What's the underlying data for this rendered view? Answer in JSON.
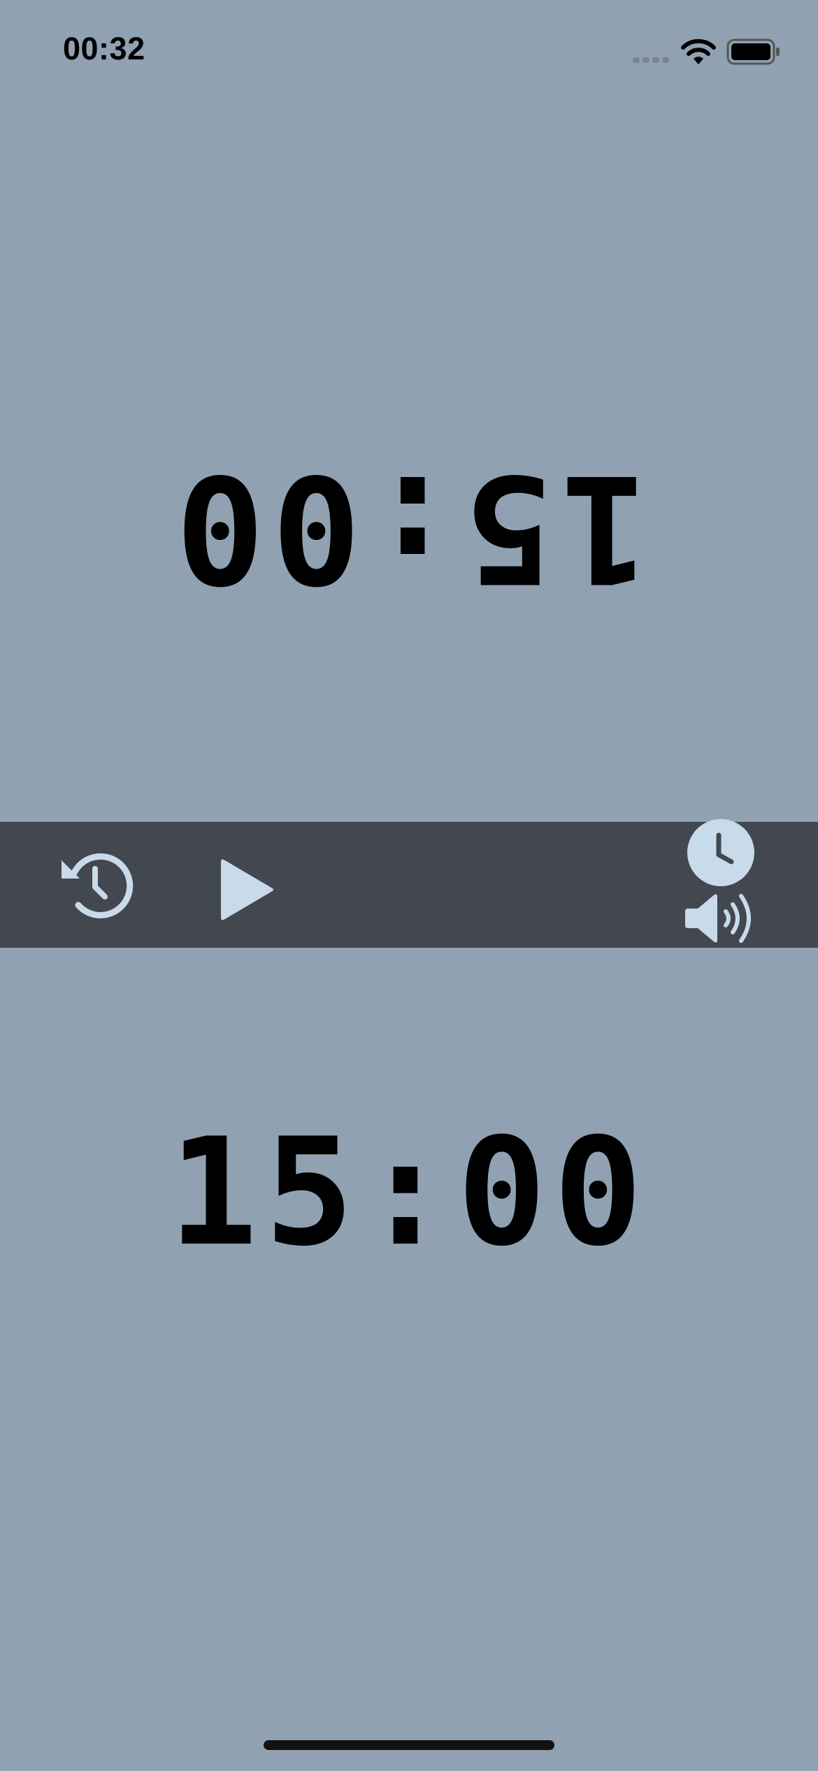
{
  "status_bar": {
    "time": "00:32",
    "signal_icon": "cellular-signal-icon",
    "wifi_icon": "wifi-icon",
    "battery_icon": "battery-icon"
  },
  "top_player": {
    "time_remaining": "15:00",
    "orientation": "upside-down"
  },
  "bottom_player": {
    "time_remaining": "15:00"
  },
  "controls": {
    "reset_icon": "reset-history-icon",
    "play_icon": "play-icon",
    "clock_icon": "clock-icon",
    "sound_icon": "speaker-wave-icon"
  },
  "colors": {
    "background": "#90a2b1",
    "control_bar": "#43474f",
    "icon_accent": "#c7dbea",
    "text": "#000000"
  }
}
